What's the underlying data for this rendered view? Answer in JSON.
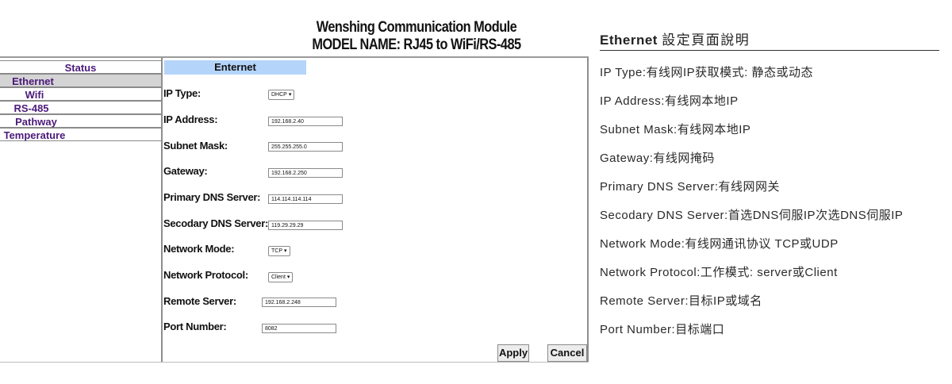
{
  "header": {
    "title": "Wenshing Communication Module",
    "model": "MODEL NAME: RJ45 to WiFi/RS-485"
  },
  "sidebar": {
    "items": [
      {
        "label": "Status",
        "active": false
      },
      {
        "label": "Ethernet",
        "active": true
      },
      {
        "label": "Wifi",
        "active": false
      },
      {
        "label": "RS-485",
        "active": false
      },
      {
        "label": "Pathway",
        "active": false
      },
      {
        "label": "Temperature",
        "active": false
      }
    ]
  },
  "main": {
    "tab_title": "Enternet",
    "fields": {
      "ip_type": {
        "label": "IP Type:",
        "value": "DHCP"
      },
      "ip_address": {
        "label": "IP Address:",
        "value": "192.168.2.40"
      },
      "subnet_mask": {
        "label": "Subnet Mask:",
        "value": "255.255.255.0"
      },
      "gateway": {
        "label": "Gateway:",
        "value": "192.168.2.250"
      },
      "primary_dns": {
        "label": "Primary DNS Server:",
        "value": "114.114.114.114"
      },
      "secondary_dns": {
        "label": "Secodary DNS Server:",
        "value": "119.29.29.29"
      },
      "network_mode": {
        "label": "Network Mode:",
        "value": "TCP"
      },
      "network_protocol": {
        "label": "Network Protocol:",
        "value": "Client"
      },
      "remote_server": {
        "label": "Remote Server:",
        "value": "192.168.2.248"
      },
      "port_number": {
        "label": "Port Number:",
        "value": "8082"
      }
    },
    "apply_label": "Apply",
    "cancel_label": "Cancel"
  },
  "explanation": {
    "title_en": "Ethernet",
    "title_cn": "設定頁面說明",
    "items": [
      "IP Type:有线网IP获取模式: 静态或动态",
      "IP Address:有线网本地IP",
      "Subnet Mask:有线网本地IP",
      "Gateway:有线网掩码",
      "Primary DNS Server:有线网网关",
      "Secodary DNS Server:首选DNS伺服IP次选DNS伺服IP",
      "Network Mode:有线网通讯协议 TCP或UDP",
      "Network Protocol:工作模式: server或Client",
      "Remote Server:目标IP或域名",
      "Port Number:目标端口"
    ]
  },
  "colors": {
    "nav_text": "#4b1a7a",
    "tab_header_bg": "#b4d4fa",
    "active_nav_bg": "#d4d4d4"
  }
}
